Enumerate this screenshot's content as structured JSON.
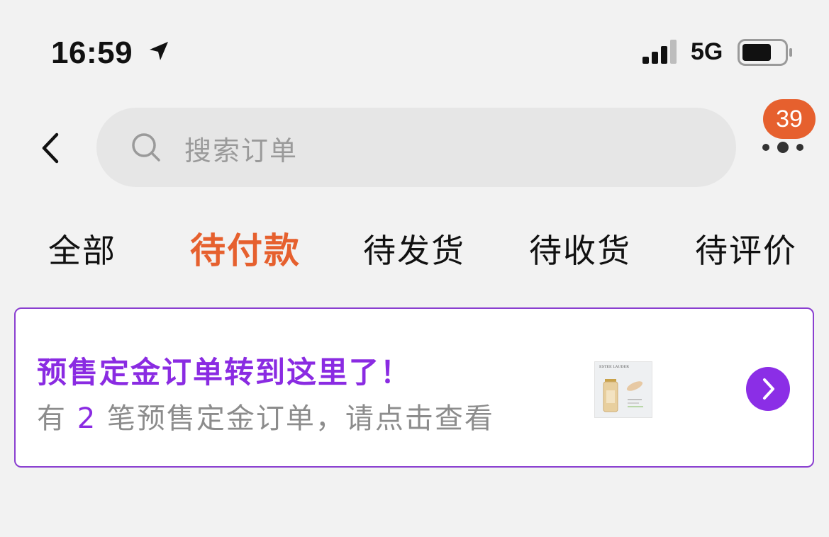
{
  "status_bar": {
    "time": "16:59",
    "network": "5G"
  },
  "header": {
    "search_placeholder": "搜索订单",
    "notification_count": "39"
  },
  "tabs": [
    {
      "label": "全部"
    },
    {
      "label": "待付款",
      "active": true
    },
    {
      "label": "待发货"
    },
    {
      "label": "待收货"
    },
    {
      "label": "待评价"
    }
  ],
  "presale_card": {
    "title": "预售定金订单转到这里了！",
    "sub_prefix": "有",
    "count": "2",
    "sub_suffix": "笔预售定金订单，请点击查看",
    "brand_text": "ESTEE LAUDER"
  },
  "colors": {
    "accent_orange": "#e6602e",
    "accent_purple": "#8b2ee6",
    "background": "#f2f2f2"
  }
}
